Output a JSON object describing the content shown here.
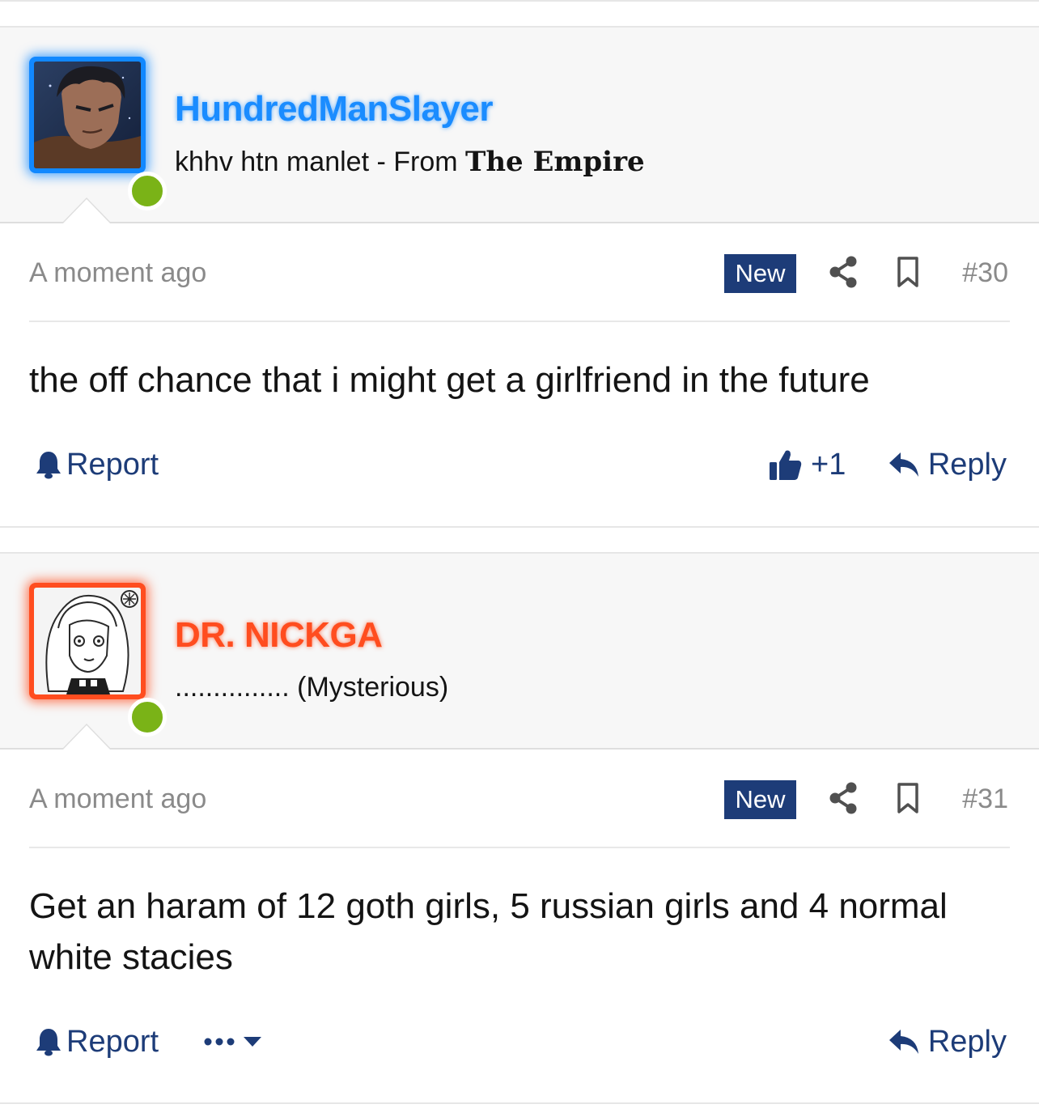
{
  "posts": [
    {
      "username": "HundredManSlayer",
      "user_title_prefix": "khhv htn manlet - From ",
      "user_title_gothic": "The Empire",
      "timestamp": "A moment ago",
      "badge": "New",
      "post_number": "#30",
      "message": "the off chance that i might get a girlfriend in the future",
      "report_label": "Report",
      "like_count": "+1",
      "reply_label": "Reply",
      "name_color": "#1a8cff",
      "avatar_border_color": "#1188ff",
      "online": true
    },
    {
      "username": "DR. NICKGA",
      "user_title": "............... (Mysterious)",
      "timestamp": "A moment ago",
      "badge": "New",
      "post_number": "#31",
      "message": "Get an haram of 12 goth girls, 5 russian girls and 4 normal white stacies",
      "report_label": "Report",
      "reply_label": "Reply",
      "name_color": "#ff4d1f",
      "avatar_border_color": "#ff4d1f",
      "online": true
    }
  ],
  "icons": {
    "online_indicator": "green-dot",
    "share": "share-icon",
    "bookmark": "bookmark-icon",
    "report": "bell-icon",
    "like": "thumbs-up-icon",
    "reply": "reply-arrow-icon",
    "more": "ellipsis-icon",
    "dropdown": "caret-down-icon"
  },
  "colors": {
    "badge_bg": "#1d3c78",
    "link": "#1d3c78",
    "online": "#7ab317",
    "muted_text": "#8a8a8a"
  }
}
